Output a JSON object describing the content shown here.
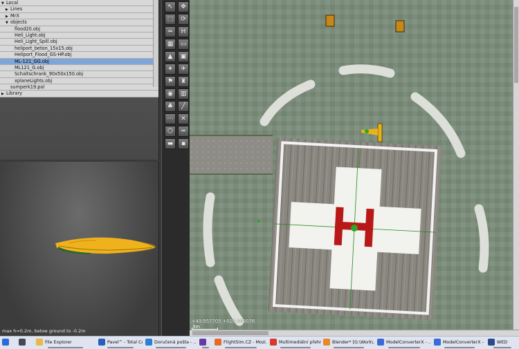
{
  "tree": {
    "items": [
      {
        "label": "Local",
        "depth": 0,
        "expander": "▼",
        "selected": false
      },
      {
        "label": "Lines",
        "depth": 1,
        "expander": "▶",
        "selected": false
      },
      {
        "label": "MrX",
        "depth": 1,
        "expander": "▶",
        "selected": false
      },
      {
        "label": "objects",
        "depth": 1,
        "expander": "▼",
        "selected": false
      },
      {
        "label": "flood20.obj",
        "depth": 2,
        "expander": "",
        "selected": false
      },
      {
        "label": "Heli_Light.obj",
        "depth": 2,
        "expander": "",
        "selected": false
      },
      {
        "label": "Heli_Light_Spill.obj",
        "depth": 2,
        "expander": "",
        "selected": false
      },
      {
        "label": "heliport_beton_15x15.obj",
        "depth": 2,
        "expander": "",
        "selected": false
      },
      {
        "label": "Heliport_Flood_GS-HP.obj",
        "depth": 2,
        "expander": "",
        "selected": false
      },
      {
        "label": "ML-121_GG.obj",
        "depth": 2,
        "expander": "",
        "selected": true
      },
      {
        "label": "ML121_G.obj",
        "depth": 2,
        "expander": "",
        "selected": false
      },
      {
        "label": "Schaltschrank_90x50x150.obj",
        "depth": 2,
        "expander": "",
        "selected": false
      },
      {
        "label": "xplaneLights.obj",
        "depth": 2,
        "expander": "",
        "selected": false
      },
      {
        "label": "sumperk19.pol",
        "depth": 1,
        "expander": "",
        "selected": false
      },
      {
        "label": "Library",
        "depth": 0,
        "expander": "▶",
        "selected": false
      }
    ]
  },
  "preview": {
    "status": "max h=0.2m, below ground to -0.2m"
  },
  "toolbar": {
    "tools": [
      {
        "name": "select-tool",
        "glyph": "↖",
        "interactive": true
      },
      {
        "name": "vertex-tool",
        "glyph": "✥",
        "interactive": true
      },
      {
        "name": "marquee-tool",
        "glyph": "⬚",
        "interactive": true
      },
      {
        "name": "rotate-tool",
        "glyph": "⟳",
        "interactive": true
      },
      {
        "name": "runway-tool",
        "glyph": "═",
        "interactive": true
      },
      {
        "name": "helipad-tool",
        "glyph": "H",
        "interactive": true
      },
      {
        "name": "taxiway-tool",
        "glyph": "▦",
        "interactive": true
      },
      {
        "name": "boundary-tool",
        "glyph": "▭",
        "interactive": true
      },
      {
        "name": "object-tool",
        "glyph": "▲",
        "interactive": true
      },
      {
        "name": "sign-tool",
        "glyph": "▣",
        "interactive": true
      },
      {
        "name": "light-tool",
        "glyph": "✦",
        "interactive": true
      },
      {
        "name": "ramp-start-tool",
        "glyph": "✈",
        "interactive": true
      },
      {
        "name": "windsock-tool",
        "glyph": "⚑",
        "interactive": true
      },
      {
        "name": "tower-tool",
        "glyph": "♜",
        "interactive": true
      },
      {
        "name": "beacon-tool",
        "glyph": "◉",
        "interactive": true
      },
      {
        "name": "facade-tool",
        "glyph": "▥",
        "interactive": true
      },
      {
        "name": "forest-tool",
        "glyph": "♣",
        "interactive": true
      },
      {
        "name": "line-tool",
        "glyph": "╱",
        "interactive": true
      },
      {
        "name": "string-tool",
        "glyph": "⋯",
        "interactive": true
      },
      {
        "name": "exclusion-tool",
        "glyph": "✕",
        "interactive": true
      },
      {
        "name": "polygon-tool",
        "glyph": "⬡",
        "interactive": true
      },
      {
        "name": "road-tool",
        "glyph": "═",
        "interactive": true
      },
      {
        "name": "draped-tool",
        "glyph": "▬",
        "interactive": true
      },
      {
        "name": "obj-string-tool",
        "glyph": "▪",
        "interactive": true
      }
    ]
  },
  "map": {
    "coords": "+49.957705 +016.963076",
    "scale": "3m"
  },
  "taskbar": {
    "items": [
      {
        "name": "start-button",
        "label": "",
        "color": "#2a6bd6",
        "open": false
      },
      {
        "name": "task-view-button",
        "label": "",
        "color": "#444a55",
        "open": false
      },
      {
        "name": "taskbar-file-explorer",
        "label": "File Explorer",
        "color": "#e8b84a",
        "open": true
      },
      {
        "name": "taskbar-total-commander",
        "label": "Pavel^ - Total Com...",
        "color": "#2a5fb8",
        "open": true
      },
      {
        "name": "taskbar-mail",
        "label": "Doručená pošta - ...",
        "color": "#2a7fd6",
        "open": true
      },
      {
        "name": "taskbar-app-viewer",
        "label": "",
        "color": "#6a3aa0",
        "open": true
      },
      {
        "name": "taskbar-firefox-flightsim",
        "label": "FlightSim.CZ - Mozi...",
        "color": "#e86a2a",
        "open": true
      },
      {
        "name": "taskbar-multimedia",
        "label": "Multimediální přehr...",
        "color": "#d63a2a",
        "open": true
      },
      {
        "name": "taskbar-blender",
        "label": "Blender* [G:\\Work\\...",
        "color": "#e8882a",
        "open": true
      },
      {
        "name": "taskbar-modelconverterx-1",
        "label": "ModelConverterX - ...",
        "color": "#3a6ad6",
        "open": true
      },
      {
        "name": "taskbar-modelconverterx-2",
        "label": "ModelConverterX - ...",
        "color": "#3a6ad6",
        "open": true
      },
      {
        "name": "taskbar-wed",
        "label": "WED",
        "color": "#2a4a8a",
        "open": true
      }
    ]
  }
}
